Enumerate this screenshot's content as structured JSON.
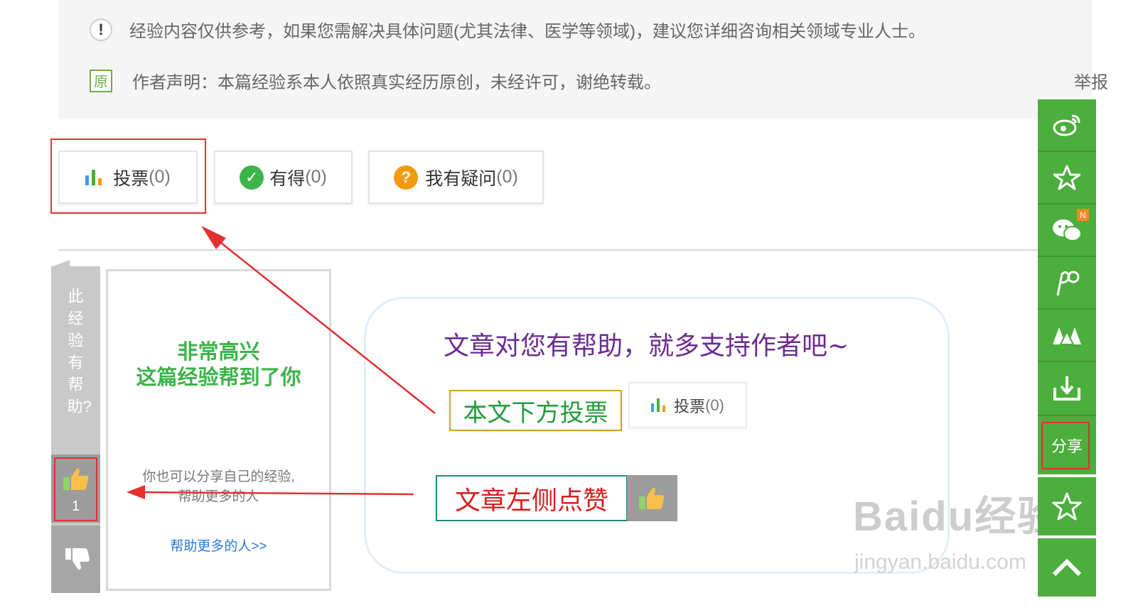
{
  "notice": {
    "disclaimer": "经验内容仅供参考，如果您需解决具体问题(尤其法律、医学等领域)，建议您详细咨询相关领域专业人士。",
    "author_statement": "作者声明：本篇经验系本人依照真实经历原创，未经许可，谢绝转载。",
    "report_label": "举报",
    "original_badge": "原"
  },
  "actions": {
    "vote_label": "投票",
    "vote_count": "(0)",
    "gain_label": "有得",
    "gain_count": "(0)",
    "question_label": "我有疑问",
    "question_count": "(0)"
  },
  "side_vote": {
    "prompt": "此经验有帮助?",
    "like_count": "1"
  },
  "promo": {
    "title_line1": "非常高兴",
    "title_line2": "这篇经验帮到了你",
    "desc_line1": "你也可以分享自己的经验,",
    "desc_line2": "帮助更多的人",
    "link": "帮助更多的人>>"
  },
  "guide": {
    "title": "文章对您有帮助，就多支持作者吧~",
    "vote_hint": "本文下方投票",
    "mini_vote_label": "投票",
    "mini_vote_count": "(0)",
    "like_hint": "文章左侧点赞"
  },
  "share_toolbar": {
    "icons": [
      "weibo-icon",
      "star-badge-icon",
      "wechat-icon",
      "tieba-icon",
      "group-icon",
      "download-icon"
    ],
    "new_badge": "N",
    "share_label": "分享",
    "favorite_icon": "star-outline-icon",
    "top_icon": "chevron-up-icon"
  },
  "watermark": {
    "brand": "Baidu经验",
    "url": "jingyan.baidu.com"
  },
  "colors": {
    "brand_green": "#4cae3c",
    "highlight_red": "#e53030",
    "title_purple": "#6a2c91"
  }
}
